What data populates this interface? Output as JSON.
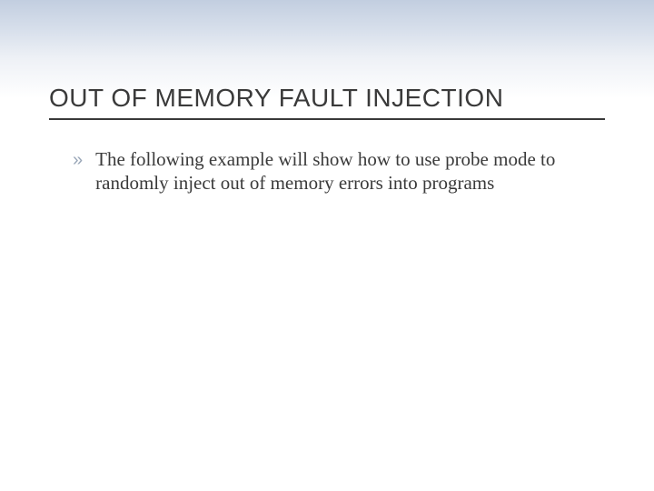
{
  "slide": {
    "title": "OUT OF MEMORY FAULT INJECTION",
    "bullets": [
      {
        "marker": "»",
        "text": "The following example will show how to use probe mode to randomly inject out of memory errors into programs"
      }
    ]
  }
}
